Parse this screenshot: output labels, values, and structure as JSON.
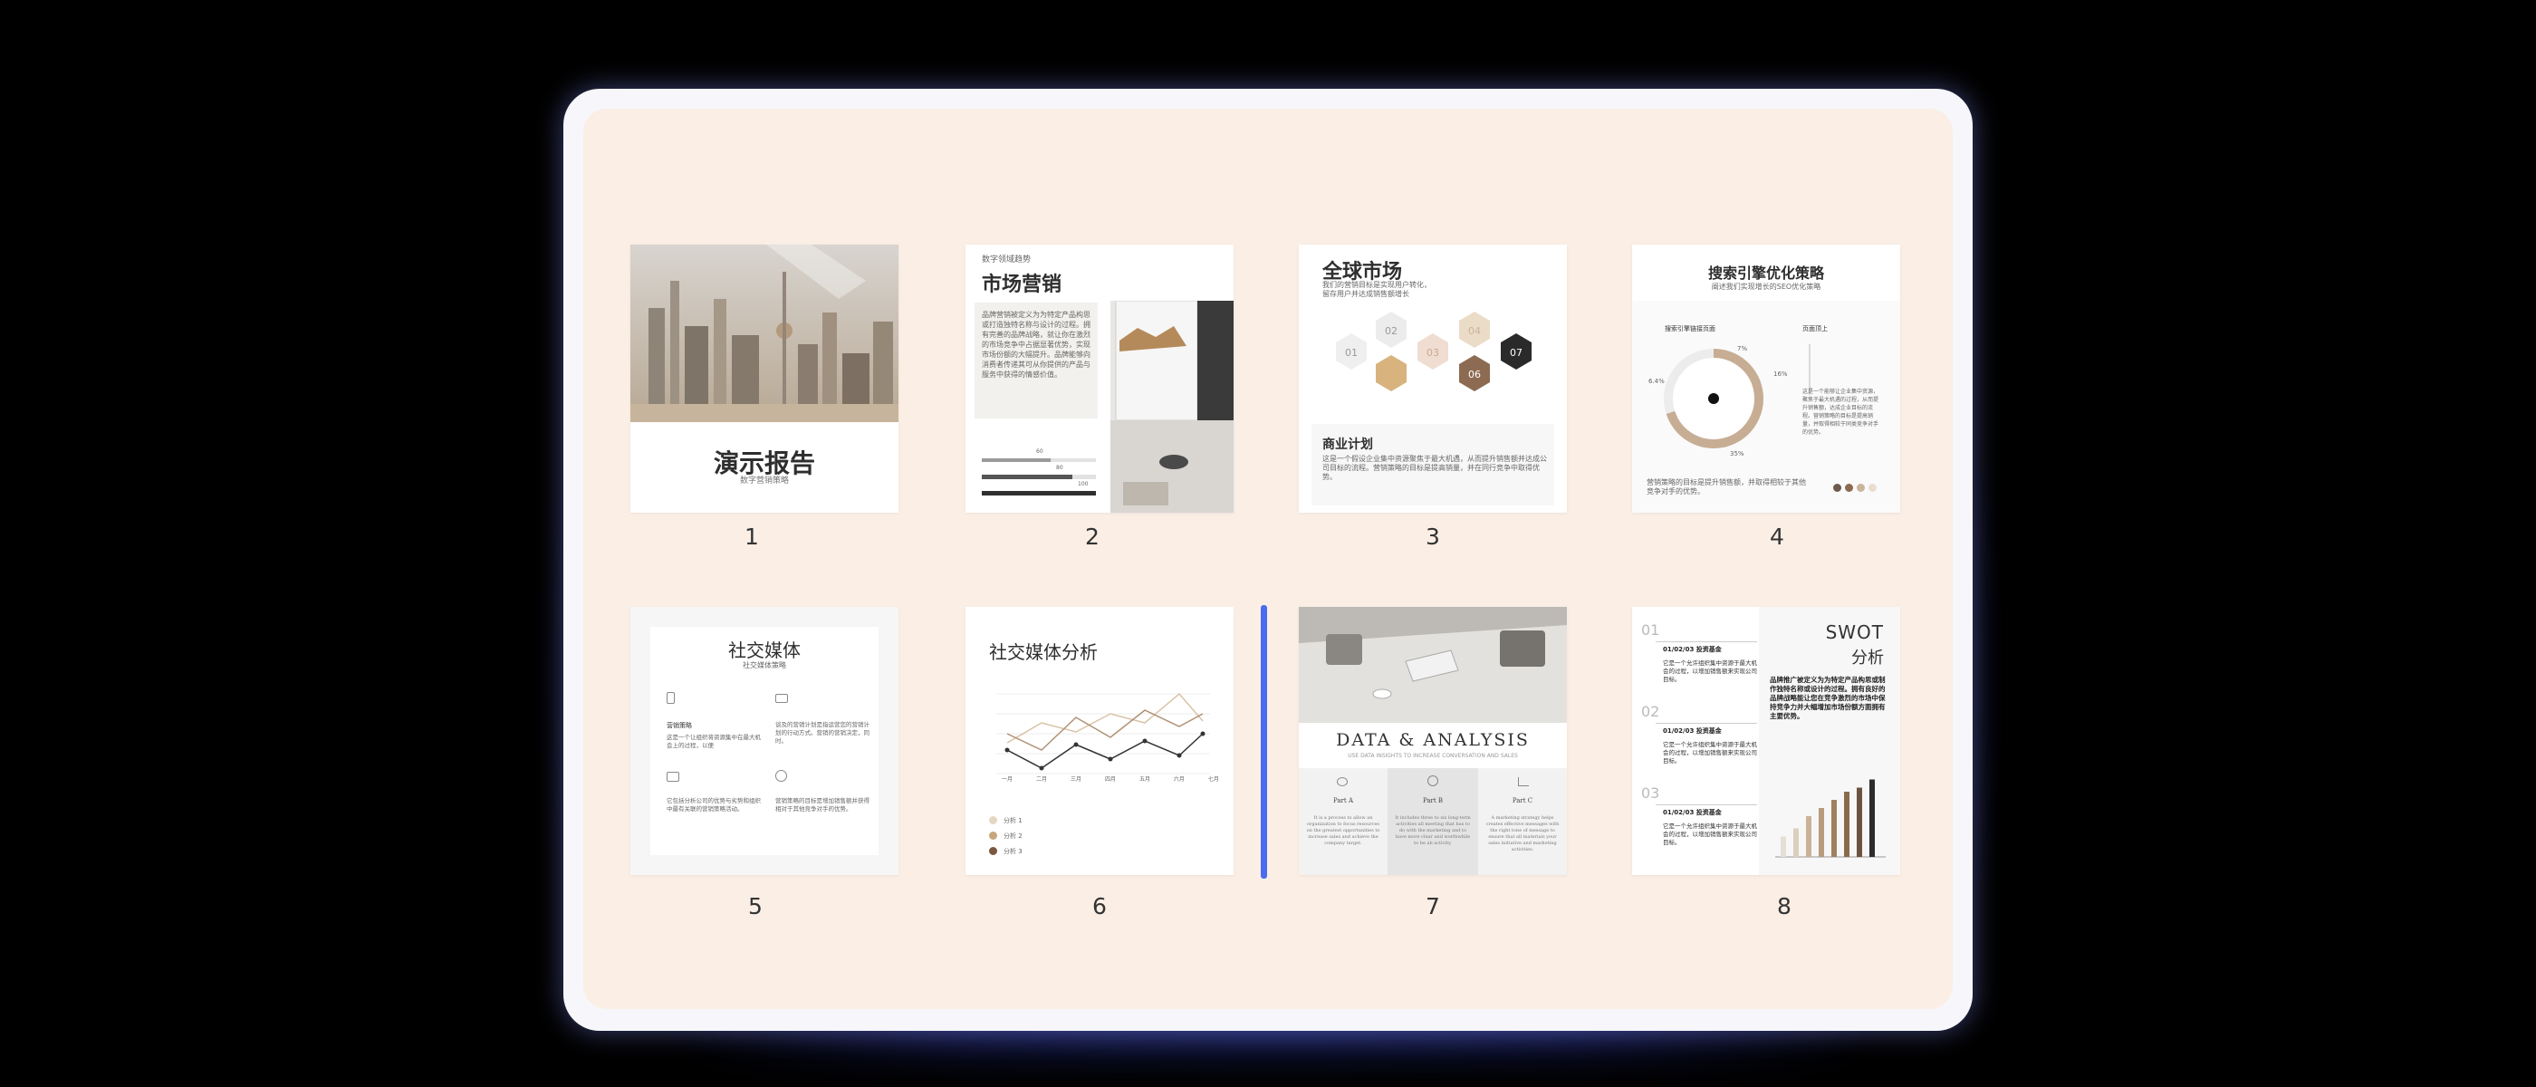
{
  "slides": [
    {
      "number": "1",
      "title": "演示报告",
      "subtitle": "数字营销策略"
    },
    {
      "number": "2",
      "kicker": "数字领域趋势",
      "title": "市场营销",
      "body": "品牌营销被定义为为特定产品构思或打造独特名称与设计的过程。拥有完善的品牌战略，就让你在激烈的市场竞争中占据显著优势，实现市场份额的大幅提升。品牌能够向消费者传递其可从你提供的产品与服务中获得的情感价值。",
      "bars": [
        {
          "label": "60",
          "value": 0.6
        },
        {
          "label": "80",
          "value": 0.8
        },
        {
          "label": "100",
          "value": 1.0
        }
      ]
    },
    {
      "number": "3",
      "title": "全球市场",
      "subtitle": "我们的营销目标是实现用户转化，留存用户并达成销售额增长",
      "hexes": [
        "01",
        "02",
        "03",
        "04",
        "06",
        "07"
      ],
      "section_title": "商业计划",
      "body": "这是一个假设企业集中资源聚焦于最大机遇，从而提升销售额并达成公司目标的流程。营销策略的目标是提高销量，并在同行竞争中取得优势。"
    },
    {
      "number": "4",
      "title": "搜索引擎优化策略",
      "subtitle": "阐述我们实现增长的SEO优化策略",
      "left_label": "搜索引擎链接页面",
      "right_label": "页面顶上",
      "pct_top": "7%",
      "pct_right": "16%",
      "pct_left": "6.4%",
      "pct_bottom": "35%",
      "gauge_value": 0.7,
      "side_text": "这是一个能够让企业集中资源，聚焦于最大机遇的过程，从而提升销售额，达成企业目标的流程。营销策略的目标是提高销量，并取得相较于同类竞争对手的优势。",
      "footer": "营销策略的目标是提升销售额，并取得相较于其他竞争对手的优势。",
      "legend_colors": [
        "#6b5a4e",
        "#8b6a4f",
        "#c9b59b",
        "#e9ddd0"
      ]
    },
    {
      "number": "5",
      "title": "社交媒体",
      "subtitle": "社交媒体策略",
      "items": [
        {
          "title": "营销策略",
          "text": "这是一个让组织将资源集中在最大机会上的过程，以便"
        },
        {
          "title": "",
          "text": "谈及的营销计划是指运营您的营销计划的行动方式。营销的营销决定，同时。"
        },
        {
          "title": "",
          "text": "它包括分析公司的优势与劣势和组织中最有关联的营销策略活动。"
        },
        {
          "title": "",
          "text": "营销策略的目标是增加销售额并获得相对于其他竞争对手的优势。"
        }
      ]
    },
    {
      "number": "6",
      "title": "社交媒体分析",
      "months": [
        "一月",
        "二月",
        "三月",
        "四月",
        "五月",
        "六月",
        "七月"
      ],
      "series": [
        {
          "name": "分析 1"
        },
        {
          "name": "分析 2"
        },
        {
          "name": "分析 3"
        }
      ]
    },
    {
      "number": "7",
      "title": "DATA & ANALYSIS",
      "subtitle": "USE DATA INSIGHTS TO INCREASE CONVERSATION AND SALES",
      "cols": [
        {
          "title": "Part A",
          "text": "It is a process to allow an organization to focus resources on the greatest opportunities to increase sales and achieve the company target."
        },
        {
          "title": "Part B",
          "text": "It includes three to six long-term activities all meeting that has to do with the marketing and to have more clear and worthwhile to be ab activity."
        },
        {
          "title": "Part C",
          "text": "A marketing strategy helps creates effective messages with the right tone of message to ensure that all materials your sales initiative and marketing activities."
        }
      ]
    },
    {
      "number": "8",
      "title": "SWOT",
      "title2": "分析",
      "entries": [
        {
          "no": "01",
          "head": "01/02/03 投资基金",
          "text": "它是一个允许组织集中资源于最大机会的过程，以增加销售额来实现公司目标。"
        },
        {
          "no": "02",
          "head": "01/02/03 投资基金",
          "text": "它是一个允许组织集中资源于最大机会的过程，以增加销售额来实现公司目标。"
        },
        {
          "no": "03",
          "head": "01/02/03 投资基金",
          "text": "它是一个允许组织集中资源于最大机会的过程，以增加销售额来实现公司目标。"
        }
      ],
      "body": "品牌推广被定义为为特定产品构思或制作独特名称或设计的过程。拥有良好的品牌战略能让您在竞争激烈的市场中保持竞争力并大幅增加市场份额方面拥有主要优势。",
      "bar_values": [
        0.25,
        0.35,
        0.5,
        0.6,
        0.7,
        0.8,
        0.85,
        0.95
      ]
    }
  ]
}
